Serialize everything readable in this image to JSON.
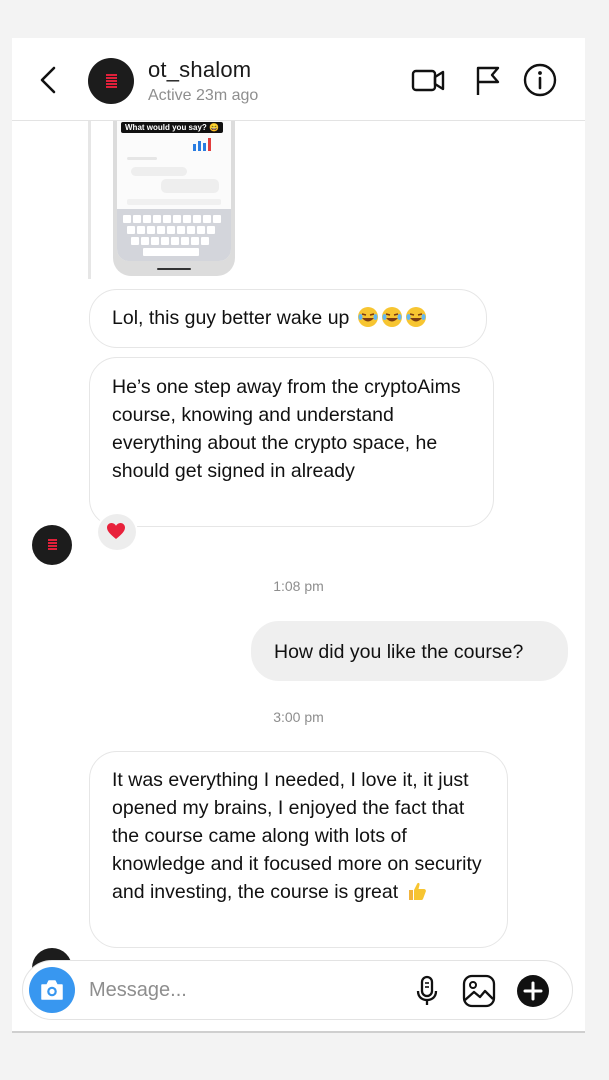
{
  "header": {
    "contact_name": "ot_shalom",
    "status": "Active 23m ago",
    "icons": [
      "chevron-left-icon",
      "video-camera-icon",
      "flag-icon",
      "info-icon"
    ]
  },
  "shared_post": {
    "caption": "What would you say? 😄"
  },
  "messages": [
    {
      "direction": "incoming",
      "text": "Lol, this guy better wake up",
      "emoji": "😂😂😂"
    },
    {
      "direction": "incoming",
      "text": "He’s one step away from the cryptoAims course, knowing and understand everything about the crypto space, he should get signed in already",
      "reaction": "❤️"
    },
    {
      "direction": "outgoing",
      "text": "How did you like the course?"
    },
    {
      "direction": "incoming",
      "text": "It was everything I needed, I love it, it just opened my brains, I enjoyed the fact that the course came along with lots of knowledge and it focused more on security and investing, the course is great",
      "emoji": "👍"
    }
  ],
  "timestamps": [
    "1:08 pm",
    "3:00 pm"
  ],
  "composer": {
    "placeholder": "Message...",
    "icons": [
      "camera-icon",
      "microphone-icon",
      "gallery-icon",
      "plus-icon"
    ]
  },
  "colors": {
    "accent": "#3897f0",
    "avatar_mark": "#e0203a",
    "bubble_border": "#e6e6e6",
    "outgoing_bubble": "#efefef"
  }
}
